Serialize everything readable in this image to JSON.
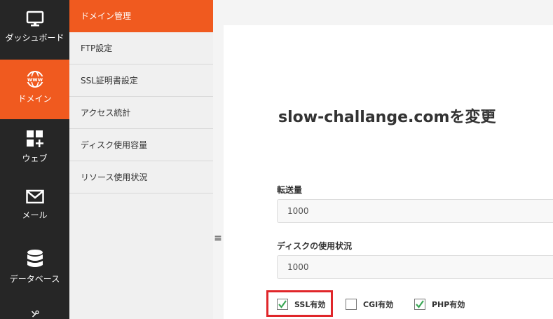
{
  "rail": {
    "items": [
      {
        "label": "ダッシュボード",
        "icon": "monitor-icon"
      },
      {
        "label": "ドメイン",
        "icon": "www-globe-icon"
      },
      {
        "label": "ウェブ",
        "icon": "grid-plus-icon"
      },
      {
        "label": "メール",
        "icon": "envelope-icon"
      },
      {
        "label": "データベース",
        "icon": "database-icon"
      },
      {
        "label": "",
        "icon": "wrench-icon"
      }
    ],
    "active_index": 1,
    "active_color": "#f05a1f",
    "bg_color": "#262626"
  },
  "submenu": {
    "items": [
      {
        "label": "ドメイン管理"
      },
      {
        "label": "FTP設定"
      },
      {
        "label": "SSL証明書設定"
      },
      {
        "label": "アクセス統計"
      },
      {
        "label": "ディスク使用容量"
      },
      {
        "label": "リソース使用状況"
      }
    ],
    "active_index": 0
  },
  "collapse_toggle": "≡",
  "main": {
    "title": "slow-challange.comを変更",
    "help_icon": "?",
    "fields": [
      {
        "label": "転送量",
        "value": "1000"
      },
      {
        "label": "ディスクの使用状況",
        "value": "1000"
      }
    ],
    "checkboxes": [
      {
        "label": "SSL有効",
        "checked": true
      },
      {
        "label": "CGI有効",
        "checked": false
      },
      {
        "label": "PHP有効",
        "checked": true
      }
    ],
    "check_color": "#3aa655",
    "highlight_color": "#e0262a"
  }
}
